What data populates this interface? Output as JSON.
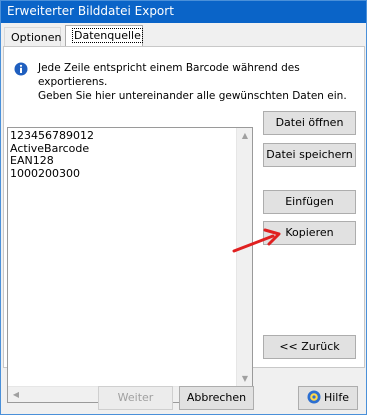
{
  "window": {
    "title": "Erweiterter Bilddatei Export"
  },
  "tabs": [
    {
      "label": "Optionen"
    },
    {
      "label": "Datenquelle"
    }
  ],
  "info": {
    "text": "Jede Zeile entspricht einem Barcode während des exportierens.\nGeben Sie hier untereinander alle gewünschten Daten ein."
  },
  "data_list": {
    "lines": [
      "123456789012",
      "ActiveBarcode",
      "EAN128",
      "1000200300"
    ]
  },
  "buttons": {
    "open": "Datei öffnen",
    "save": "Datei speichern",
    "insert": "Einfügen",
    "copy": "Kopieren",
    "back": "<< Zurück",
    "next": "Weiter",
    "cancel": "Abbrechen",
    "help": "Hilfe"
  },
  "colors": {
    "titlebar": "#0a64c8",
    "annotation_arrow": "#e02020"
  }
}
